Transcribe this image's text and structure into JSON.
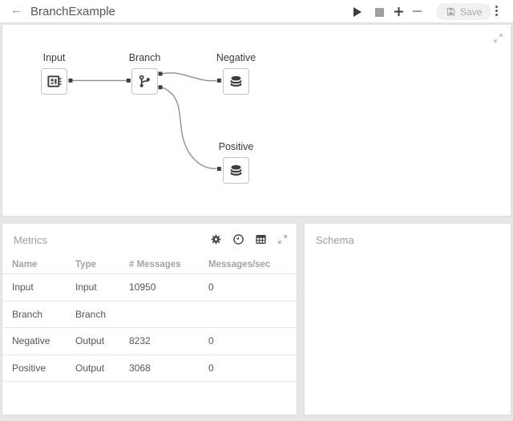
{
  "header": {
    "back_icon": "←",
    "title": "BranchExample",
    "toolbar": {
      "save_label": "Save"
    }
  },
  "canvas": {
    "nodes": [
      {
        "id": "input",
        "label": "Input",
        "icon": "input-window-icon"
      },
      {
        "id": "branch",
        "label": "Branch",
        "icon": "branch-icon"
      },
      {
        "id": "negative",
        "label": "Negative",
        "icon": "database-icon"
      },
      {
        "id": "positive",
        "label": "Positive",
        "icon": "database-icon"
      }
    ],
    "edges": [
      {
        "from": "Input",
        "to": "Branch"
      },
      {
        "from": "Branch",
        "to": "Negative"
      },
      {
        "from": "Branch",
        "to": "Positive"
      }
    ]
  },
  "metrics": {
    "title": "Metrics",
    "icons": [
      "settings-icon",
      "history-icon",
      "table-icon",
      "expand-icon"
    ],
    "columns": [
      "Name",
      "Type",
      "# Messages",
      "Messages/sec"
    ],
    "rows": [
      {
        "name": "Input",
        "type": "Input",
        "messages": "10950",
        "messages_per_sec": "0"
      },
      {
        "name": "Branch",
        "type": "Branch",
        "messages": "",
        "messages_per_sec": ""
      },
      {
        "name": "Negative",
        "type": "Output",
        "messages": "8232",
        "messages_per_sec": "0"
      },
      {
        "name": "Positive",
        "type": "Output",
        "messages": "3068",
        "messages_per_sec": "0"
      }
    ]
  },
  "schema": {
    "title": "Schema"
  },
  "colors": {
    "icon_dark": "#3d3d3d",
    "muted_gray": "#9e9e9e",
    "edge_gray": "#8f8f8f",
    "panel_border": "#e2e2e2"
  }
}
